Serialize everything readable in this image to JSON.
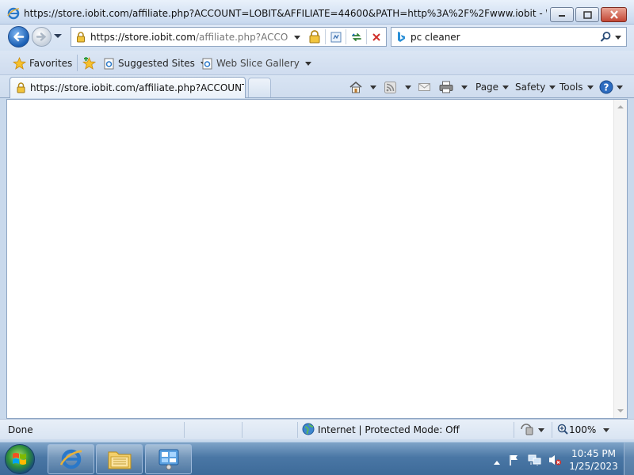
{
  "window": {
    "title": "https://store.iobit.com/affiliate.php?ACCOUNT=LOBIT&AFFILIATE=44600&PATH=http%3A%2F%2Fwww.iobit - Windows I..."
  },
  "address_bar": {
    "url_host": "https://store.iobit.com",
    "url_path": "/affiliate.php?ACCOUNT"
  },
  "search": {
    "query": "pc cleaner"
  },
  "favorites_bar": {
    "favorites_label": "Favorites",
    "suggested_sites": "Suggested Sites",
    "web_slice_gallery": "Web Slice Gallery"
  },
  "tabs": [
    {
      "title": "https://store.iobit.com/affiliate.php?ACCOUNT=..."
    }
  ],
  "command_bar": {
    "page": "Page",
    "safety": "Safety",
    "tools": "Tools"
  },
  "status_bar": {
    "status": "Done",
    "zone": "Internet | Protected Mode: Off",
    "zoom": "100%"
  },
  "taskbar": {
    "time": "10:45 PM",
    "date": "1/25/2023"
  },
  "colors": {
    "accent": "#1a5fb4",
    "chrome": "#d4e2f3",
    "taskbar": "#4a77a5"
  }
}
